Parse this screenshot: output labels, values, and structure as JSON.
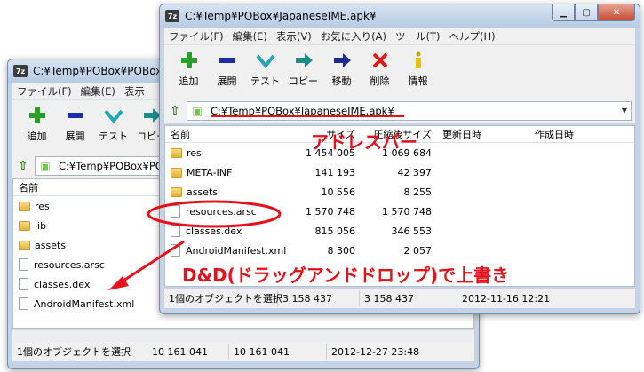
{
  "back_window": {
    "title": "C:¥Temp¥POBox¥POBox",
    "menu": [
      "ファイル(F)",
      "編集(E)",
      "表示"
    ],
    "toolbar": [
      {
        "label": "追加",
        "icon": "plus-icon"
      },
      {
        "label": "展開",
        "icon": "minus-icon"
      },
      {
        "label": "テスト",
        "icon": "checkmark-icon"
      },
      {
        "label": "コピー",
        "icon": "copy-arrow-icon"
      }
    ],
    "address": "C:¥Temp¥POBox¥POBox",
    "column_name": "名前",
    "files": [
      {
        "name": "res",
        "type": "folder"
      },
      {
        "name": "lib",
        "type": "folder"
      },
      {
        "name": "assets",
        "type": "folder"
      },
      {
        "name": "resources.arsc",
        "type": "file"
      },
      {
        "name": "classes.dex",
        "type": "file"
      },
      {
        "name": "AndroidManifest.xml",
        "type": "file"
      }
    ],
    "status": [
      "1個のオブジェクトを選択",
      "10 161 041",
      "10 161 041",
      "2012-12-27 23:48"
    ]
  },
  "front_window": {
    "title": "C:¥Temp¥POBox¥JapaneseIME.apk¥",
    "menu": [
      "ファイル(F)",
      "編集(E)",
      "表示(V)",
      "お気に入り(A)",
      "ツール(T)",
      "ヘルプ(H)"
    ],
    "toolbar": [
      {
        "label": "追加",
        "icon": "plus-icon"
      },
      {
        "label": "展開",
        "icon": "minus-icon"
      },
      {
        "label": "テスト",
        "icon": "checkmark-icon"
      },
      {
        "label": "コピー",
        "icon": "copy-arrow-icon"
      },
      {
        "label": "移動",
        "icon": "move-arrow-icon"
      },
      {
        "label": "削除",
        "icon": "delete-x-icon"
      },
      {
        "label": "情報",
        "icon": "info-icon"
      }
    ],
    "address": "C:¥Temp¥POBox¥JapaneseIME.apk¥",
    "columns": [
      "名前",
      "サイズ",
      "圧縮後サイズ",
      "更新日時",
      "作成日時"
    ],
    "files": [
      {
        "name": "res",
        "type": "folder",
        "size": "1 454 005",
        "packed": "1 069 684",
        "modified": ""
      },
      {
        "name": "META-INF",
        "type": "folder",
        "size": "141 193",
        "packed": "42 397",
        "modified": ""
      },
      {
        "name": "assets",
        "type": "folder",
        "size": "10 556",
        "packed": "8 255",
        "modified": ""
      },
      {
        "name": "resources.arsc",
        "type": "file",
        "size": "1 570 748",
        "packed": "1 570 748",
        "modified": ""
      },
      {
        "name": "classes.dex",
        "type": "file",
        "size": "815 056",
        "packed": "346 553",
        "modified": ""
      },
      {
        "name": "AndroidManifest.xml",
        "type": "file",
        "size": "8 300",
        "packed": "2 057",
        "modified": ""
      }
    ],
    "status": [
      "1個のオブジェクトを選択",
      "3 158 437",
      "3 158 437",
      "2012-11-16 12:21"
    ]
  },
  "annotations": {
    "address_bar": "アドレスバー",
    "drag_drop": "D&D(ドラッグアンドドロップ)で上書き"
  },
  "colors": {
    "annotation": "#e8111b",
    "window_frame": "#c4d3e6"
  }
}
